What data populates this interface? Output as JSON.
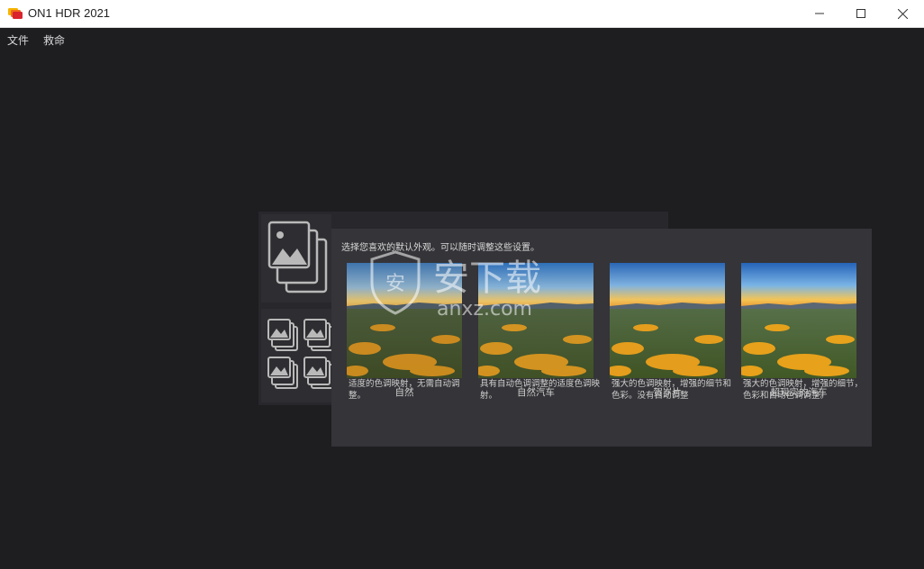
{
  "window": {
    "title": "ON1 HDR 2021"
  },
  "menu": {
    "items": [
      "文件",
      "救命"
    ]
  },
  "popup": {
    "title": "选择您喜欢的默认外观。可以随时调整这些设置。",
    "presets": [
      {
        "name": "自然",
        "description": "适度的色调映射，无需自动调整。"
      },
      {
        "name": "自然汽车",
        "description": "具有自动色调调整的适度色调映射。"
      },
      {
        "name": "贺岁片",
        "description": "强大的色调映射，增强的细节和色彩。没有自动调整"
      },
      {
        "name": "超现实的汽车",
        "description": "强大的色调映射，增强的细节，色彩和自动色调调整。"
      }
    ]
  },
  "watermark": {
    "cn": "安下载",
    "en": "anxz.com"
  },
  "colors": {
    "background": "#1e1d20",
    "popup": "#353438",
    "panel": "#28272b"
  },
  "icons": [
    "app-logo-icon",
    "minimize-icon",
    "maximize-icon",
    "close-icon",
    "single-photo-icon",
    "batch-photos-icon"
  ]
}
